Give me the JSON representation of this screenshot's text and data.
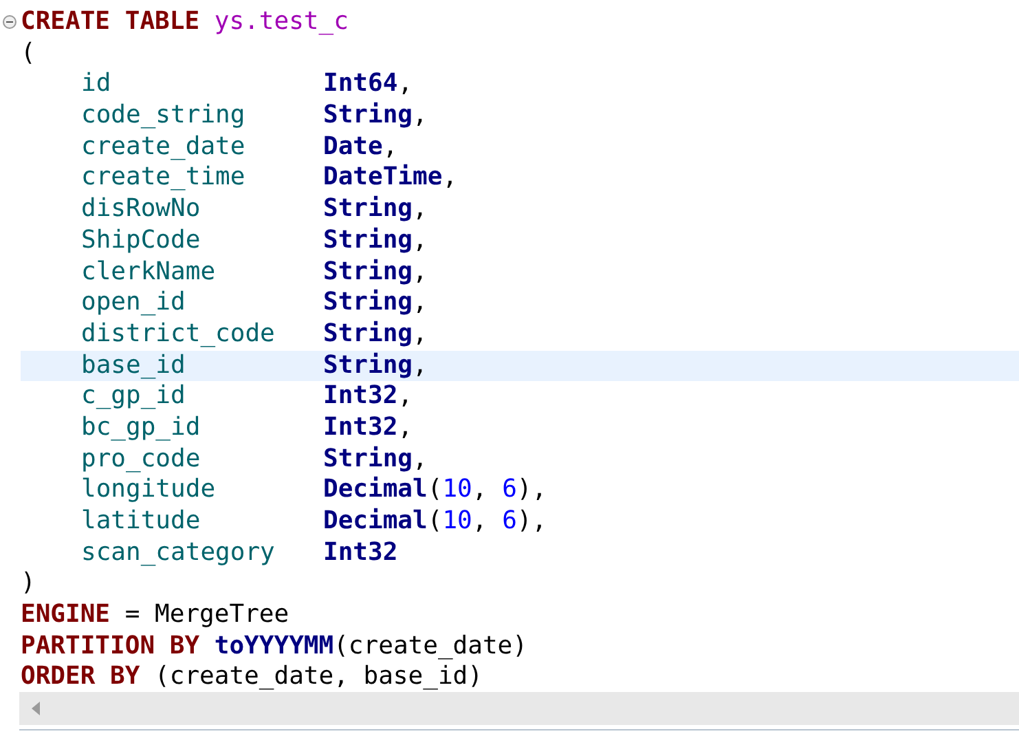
{
  "editor": {
    "lines": [
      {
        "kind": "statement",
        "foldable": true,
        "selected": false,
        "segments": [
          {
            "kind": "keyword",
            "text": "CREATE TABLE"
          },
          {
            "kind": "table",
            "text": " ys.test_c"
          }
        ]
      },
      {
        "kind": "statement",
        "foldable": false,
        "selected": false,
        "segments": [
          {
            "kind": "plain",
            "text": "("
          }
        ]
      },
      {
        "kind": "column",
        "foldable": false,
        "selected": false,
        "name": "id",
        "type": [
          {
            "kind": "type",
            "text": "Int64"
          },
          {
            "kind": "plain",
            "text": ","
          }
        ]
      },
      {
        "kind": "column",
        "foldable": false,
        "selected": false,
        "name": "code_string",
        "type": [
          {
            "kind": "type",
            "text": "String"
          },
          {
            "kind": "plain",
            "text": ","
          }
        ]
      },
      {
        "kind": "column",
        "foldable": false,
        "selected": false,
        "name": "create_date",
        "type": [
          {
            "kind": "type",
            "text": "Date"
          },
          {
            "kind": "plain",
            "text": ","
          }
        ]
      },
      {
        "kind": "column",
        "foldable": false,
        "selected": false,
        "name": "create_time",
        "type": [
          {
            "kind": "type",
            "text": "DateTime"
          },
          {
            "kind": "plain",
            "text": ","
          }
        ]
      },
      {
        "kind": "column",
        "foldable": false,
        "selected": false,
        "name": "disRowNo",
        "type": [
          {
            "kind": "type",
            "text": "String"
          },
          {
            "kind": "plain",
            "text": ","
          }
        ]
      },
      {
        "kind": "column",
        "foldable": false,
        "selected": false,
        "name": "ShipCode",
        "type": [
          {
            "kind": "type",
            "text": "String"
          },
          {
            "kind": "plain",
            "text": ","
          }
        ]
      },
      {
        "kind": "column",
        "foldable": false,
        "selected": false,
        "name": "clerkName",
        "type": [
          {
            "kind": "type",
            "text": "String"
          },
          {
            "kind": "plain",
            "text": ","
          }
        ]
      },
      {
        "kind": "column",
        "foldable": false,
        "selected": false,
        "name": "open_id",
        "type": [
          {
            "kind": "type",
            "text": "String"
          },
          {
            "kind": "plain",
            "text": ","
          }
        ]
      },
      {
        "kind": "column",
        "foldable": false,
        "selected": false,
        "name": "district_code",
        "type": [
          {
            "kind": "type",
            "text": "String"
          },
          {
            "kind": "plain",
            "text": ","
          }
        ]
      },
      {
        "kind": "column",
        "foldable": false,
        "selected": true,
        "name": "base_id",
        "type": [
          {
            "kind": "type",
            "text": "String"
          },
          {
            "kind": "plain",
            "text": ","
          }
        ]
      },
      {
        "kind": "column",
        "foldable": false,
        "selected": false,
        "name": "c_gp_id",
        "type": [
          {
            "kind": "type",
            "text": "Int32"
          },
          {
            "kind": "plain",
            "text": ","
          }
        ]
      },
      {
        "kind": "column",
        "foldable": false,
        "selected": false,
        "name": "bc_gp_id",
        "type": [
          {
            "kind": "type",
            "text": "Int32"
          },
          {
            "kind": "plain",
            "text": ","
          }
        ]
      },
      {
        "kind": "column",
        "foldable": false,
        "selected": false,
        "name": "pro_code",
        "type": [
          {
            "kind": "type",
            "text": "String"
          },
          {
            "kind": "plain",
            "text": ","
          }
        ]
      },
      {
        "kind": "column",
        "foldable": false,
        "selected": false,
        "name": "longitude",
        "type": [
          {
            "kind": "type",
            "text": "Decimal"
          },
          {
            "kind": "plain",
            "text": "("
          },
          {
            "kind": "number",
            "text": "10"
          },
          {
            "kind": "plain",
            "text": ", "
          },
          {
            "kind": "number",
            "text": "6"
          },
          {
            "kind": "plain",
            "text": "),"
          }
        ]
      },
      {
        "kind": "column",
        "foldable": false,
        "selected": false,
        "name": "latitude",
        "type": [
          {
            "kind": "type",
            "text": "Decimal"
          },
          {
            "kind": "plain",
            "text": "("
          },
          {
            "kind": "number",
            "text": "10"
          },
          {
            "kind": "plain",
            "text": ", "
          },
          {
            "kind": "number",
            "text": "6"
          },
          {
            "kind": "plain",
            "text": "),"
          }
        ]
      },
      {
        "kind": "column",
        "foldable": false,
        "selected": false,
        "name": "scan_category",
        "type": [
          {
            "kind": "type",
            "text": "Int32"
          }
        ]
      },
      {
        "kind": "statement",
        "foldable": false,
        "selected": false,
        "segments": [
          {
            "kind": "plain",
            "text": ")"
          }
        ]
      },
      {
        "kind": "statement",
        "foldable": false,
        "selected": false,
        "segments": [
          {
            "kind": "keyword",
            "text": "ENGINE"
          },
          {
            "kind": "plain",
            "text": " = MergeTree"
          }
        ]
      },
      {
        "kind": "statement",
        "foldable": false,
        "selected": false,
        "segments": [
          {
            "kind": "keyword",
            "text": "PARTITION BY"
          },
          {
            "kind": "function",
            "text": " toYYYYMM"
          },
          {
            "kind": "plain",
            "text": "(create_date)"
          }
        ]
      },
      {
        "kind": "statement",
        "foldable": false,
        "selected": false,
        "segments": [
          {
            "kind": "keyword",
            "text": "ORDER BY"
          },
          {
            "kind": "plain",
            "text": " (create_date, base_id)"
          }
        ]
      }
    ]
  }
}
